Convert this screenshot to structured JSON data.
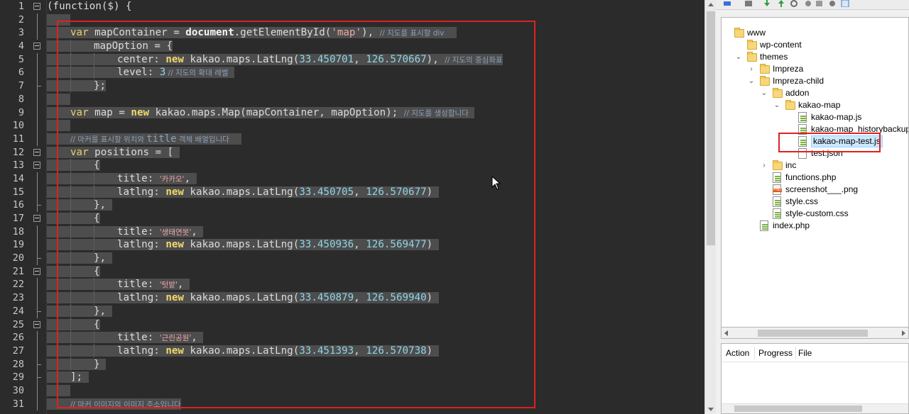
{
  "editor": {
    "line_numbers": [
      "1",
      "2",
      "3",
      "4",
      "5",
      "6",
      "7",
      "8",
      "9",
      "10",
      "11",
      "12",
      "13",
      "14",
      "15",
      "16",
      "17",
      "18",
      "19",
      "20",
      "21",
      "22",
      "23",
      "24",
      "25",
      "26",
      "27",
      "28",
      "29",
      "30",
      "31"
    ],
    "code": {
      "l1": "(function($) {",
      "l3_kw": "var",
      "l3_a": " mapContainer = ",
      "l3_fn": "document",
      "l3_b": ".getElementById(",
      "l3_str": "'map'",
      "l3_c": "), ",
      "l3_cmt": "// 지도를 표시할 div",
      "l4_a": "mapOption = {",
      "l5_a": "center: ",
      "l5_new": "new",
      "l5_b": " kakao.maps.LatLng(",
      "l5_n1": "33.450701",
      "l5_c": ", ",
      "l5_n2": "126.570667",
      "l5_d": "), ",
      "l5_cmt": "// 지도의 중심좌표",
      "l6_a": "level: ",
      "l6_num": "3",
      "l6_cmt": " // 지도의 확대 레벨",
      "l7_a": "};",
      "l9_kw": "var",
      "l9_a": " map = ",
      "l9_new": "new",
      "l9_b": " kakao.maps.Map(mapContainer, mapOption); ",
      "l9_cmt": "// 지도를 생성합니다",
      "l11_cmt_a": "// 마커를 표시할 위치와 ",
      "l11_cmt_b": "title",
      "l11_cmt_c": " 객체 배열입니다",
      "l12_kw": "var",
      "l12_a": " positions = [",
      "open_brace": "{",
      "close_brace_comma": "},",
      "close_brace": "}",
      "title_key": "title: ",
      "latlng_key": "latlng: ",
      "new_kw": "new",
      "latlng_call": " kakao.maps.LatLng(",
      "comma_sp": ", ",
      "close_paren": ")",
      "close_paren_comma": ",",
      "positions": [
        {
          "title": "'카카오'",
          "lat": "33.450705",
          "lng": "126.570677"
        },
        {
          "title": "'생태연못'",
          "lat": "33.450936",
          "lng": "126.569477"
        },
        {
          "title": "'텃밭'",
          "lat": "33.450879",
          "lng": "126.569940"
        },
        {
          "title": "'근린공원'",
          "lat": "33.451393",
          "lng": "126.570738"
        }
      ],
      "l29_a": "];",
      "l31_cmt": "// 마커 이미지의 이미지 주소입니다"
    }
  },
  "tree": {
    "items": [
      {
        "label": "www",
        "type": "folder"
      },
      {
        "label": "wp-content",
        "type": "folder"
      },
      {
        "label": "themes",
        "type": "folder"
      },
      {
        "label": "Impreza",
        "type": "folder"
      },
      {
        "label": "Impreza-child",
        "type": "folder"
      },
      {
        "label": "addon",
        "type": "folder"
      },
      {
        "label": "kakao-map",
        "type": "folder"
      },
      {
        "label": "kakao-map.js",
        "type": "file"
      },
      {
        "label": "kakao-map_historybackup.js",
        "type": "file"
      },
      {
        "label": "kakao-map-test.js",
        "type": "file",
        "selected": true
      },
      {
        "label": "test.json",
        "type": "file"
      },
      {
        "label": "inc",
        "type": "folder"
      },
      {
        "label": "functions.php",
        "type": "file"
      },
      {
        "label": "screenshot___.png",
        "type": "file"
      },
      {
        "label": "style.css",
        "type": "file"
      },
      {
        "label": "style-custom.css",
        "type": "file"
      },
      {
        "label": "index.php",
        "type": "file"
      }
    ]
  },
  "queue": {
    "headers": [
      "Action",
      "Progress",
      "File"
    ]
  },
  "colors": {
    "highlight_border": "#e02020",
    "selection": "#4d4d4d",
    "tree_selected": "#cce8ff"
  }
}
